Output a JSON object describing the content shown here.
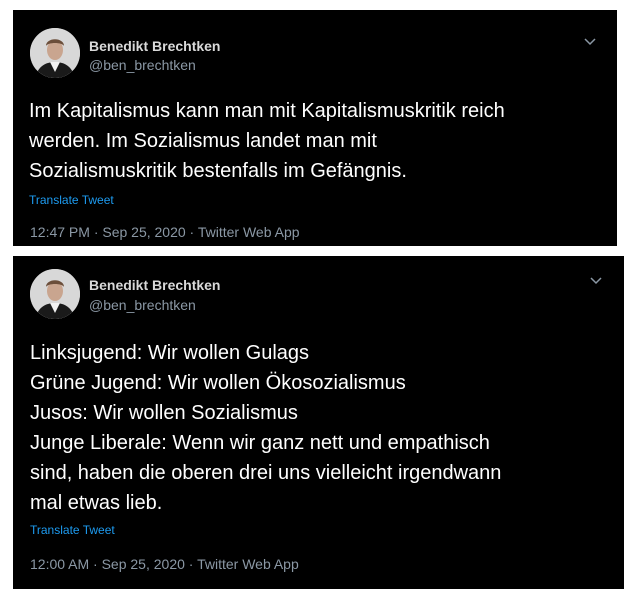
{
  "tweets": [
    {
      "author": {
        "name": "Benedikt Brechtken",
        "handle": "@ben_brechtken",
        "avatar_icon": "profile-photo"
      },
      "text_lines": [
        "Im Kapitalismus kann man mit Kapitalismuskritik reich",
        "werden. Im Sozialismus landet man mit",
        "Sozialismuskritik bestenfalls im Gefängnis."
      ],
      "translate_label": "Translate Tweet",
      "meta": "12:47 PM · Sep 25, 2020 · Twitter Web App",
      "menu_icon": "chevron-down-icon"
    },
    {
      "author": {
        "name": "Benedikt Brechtken",
        "handle": "@ben_brechtken",
        "avatar_icon": "profile-photo"
      },
      "text_lines": [
        "Linksjugend: Wir wollen Gulags",
        "Grüne Jugend: Wir wollen Ökosozialismus",
        "Jusos: Wir wollen Sozialismus",
        "Junge Liberale: Wenn wir ganz nett und empathisch",
        "sind, haben die oberen drei uns vielleicht irgendwann",
        "mal etwas lieb."
      ],
      "translate_label": "Translate Tweet",
      "meta": "12:00 AM · Sep 25, 2020 · Twitter Web App",
      "menu_icon": "chevron-down-icon"
    }
  ],
  "colors": {
    "background": "#000000",
    "text": "#ffffff",
    "secondary": "#8b98a5",
    "link": "#1d9bf0"
  }
}
